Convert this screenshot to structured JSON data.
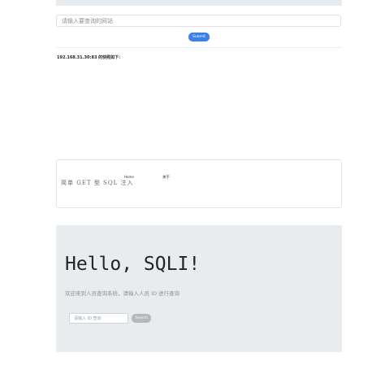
{
  "url_form": {
    "placeholder": "请输入要查询的网站",
    "submit_label": "Submit"
  },
  "result": {
    "label": "192.168.31.30:83 的快照如下："
  },
  "snapshot": {
    "title": "简单 GET 型 SQL 注入",
    "nav_home": "Home",
    "nav_about": "关于"
  },
  "hero": {
    "title": "Hello, SQLI!",
    "description": "欢迎来到人员查询系统，请输入人员 ID 进行查询",
    "id_placeholder": "请输入 ID 查询",
    "search_label": "Search"
  },
  "colors": {
    "submit": "#3b82e6",
    "jumbotron": "#e9ecef",
    "search": "#b3b8bd"
  }
}
